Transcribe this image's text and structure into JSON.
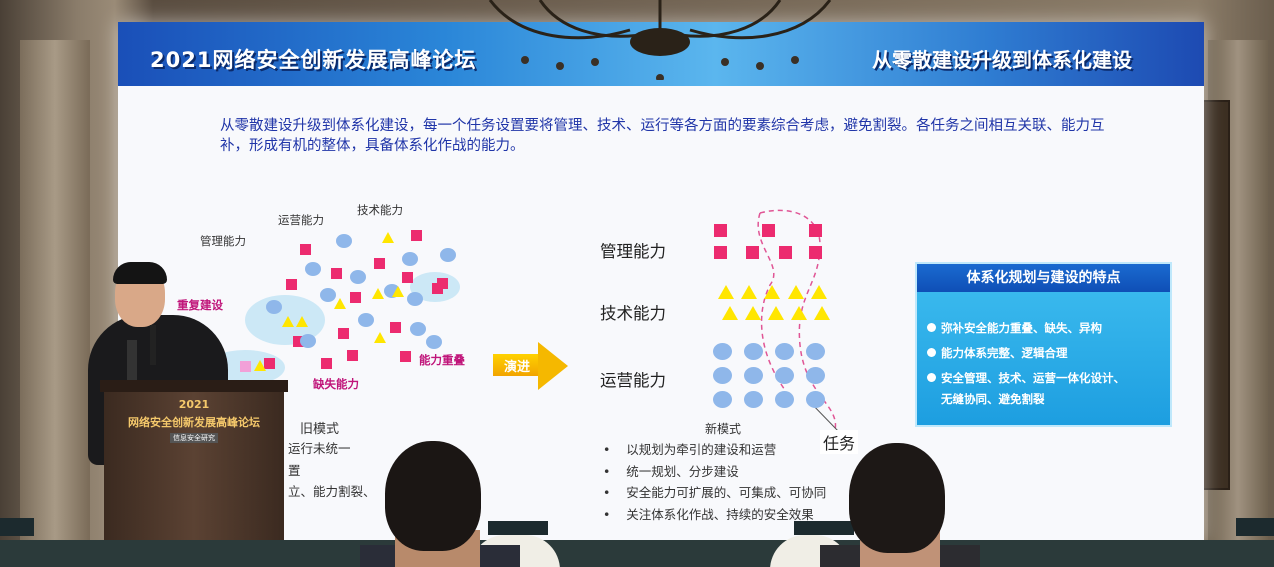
{
  "banner": {
    "title": "2021网络安全创新发展高峰论坛",
    "right": "从零散建设升级到体系化建设"
  },
  "intro": "从零散建设升级到体系化建设，每一个任务设置要将管理、技术、运行等各方面的要素综合考虑，避免割裂。各任务之间相互关联、能力互补，形成有机的整体，具备体系化作战的能力。",
  "old_diagram": {
    "labels": {
      "tech": "技术能力",
      "ops": "运营能力",
      "mgmt": "管理能力",
      "repeat": "重复建设",
      "overlap": "能力重叠",
      "missing": "缺失能力"
    },
    "caption": "旧模式"
  },
  "arrow_label": "演进",
  "new_diagram": {
    "rows": [
      "管理能力",
      "技术能力",
      "运营能力"
    ],
    "task": "任务",
    "caption": "新模式"
  },
  "old_mode_items": [
    "运行未统一",
    "置",
    "立、能力割裂、"
  ],
  "new_mode_items": [
    "以规划为牵引的建设和运营",
    "统一规划、分步建设",
    "安全能力可扩展的、可集成、可协同",
    "关注体系化作战、持续的安全效果"
  ],
  "feature_box": {
    "title": "体系化规划与建设的特点",
    "items": [
      "弥补安全能力重叠、缺失、异构",
      "能力体系完整、逻辑合理",
      "安全管理、技术、运营一体化设计、",
      "无缝协同、避免割裂"
    ]
  },
  "podium": {
    "line1": "2021",
    "line2": "网络安全创新发展高峰论坛",
    "line3": "信息安全研究"
  },
  "colors": {
    "banner": "#2a86d8",
    "square": "#ec2b6f",
    "triangle": "#ffe600",
    "circle": "#8fb7ea",
    "intro_text": "#2035a8"
  }
}
